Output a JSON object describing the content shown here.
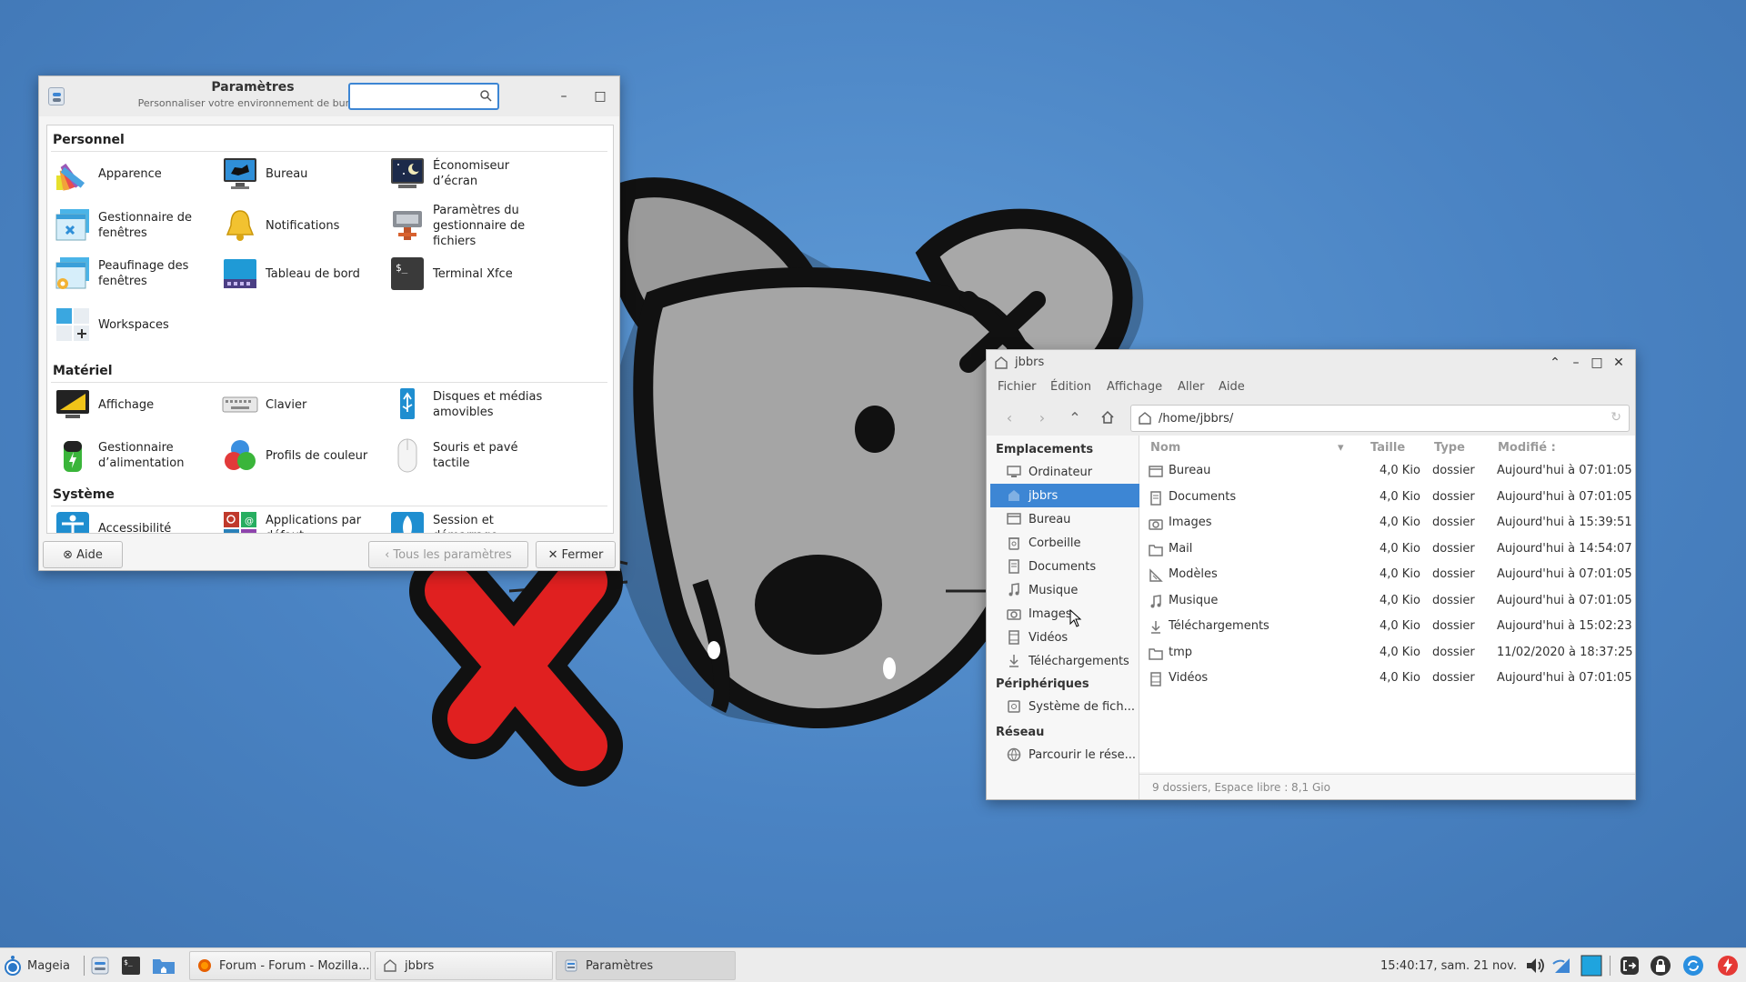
{
  "settings": {
    "title": "Paramètres",
    "subtitle": "Personnaliser votre environnement de bureau",
    "search_value": "",
    "sections": {
      "personnel": "Personnel",
      "materiel": "Matériel",
      "systeme": "Système"
    },
    "items": {
      "apparence": "Apparence",
      "bureau": "Bureau",
      "economiseur": "Économiseur d’écran",
      "gestionnaire_fenetres": "Gestionnaire de fenêtres",
      "notifications": "Notifications",
      "param_gestionnaire_fichiers": "Paramètres du gestionnaire de fichiers",
      "peaufinage": "Peaufinage des fenêtres",
      "tableau_de_bord": "Tableau de bord",
      "terminal": "Terminal Xfce",
      "workspaces": "Workspaces",
      "affichage": "Affichage",
      "clavier": "Clavier",
      "disques": "Disques et médias amovibles",
      "alimentation": "Gestionnaire d’alimentation",
      "profils_couleur": "Profils de couleur",
      "souris": "Souris et pavé tactile",
      "accessibilite": "Accessibilité",
      "applications_defaut": "Applications par défaut",
      "session": "Session et démarrage"
    },
    "footer": {
      "help": "Aide",
      "all_settings": "Tous les paramètres",
      "close": "Fermer"
    }
  },
  "filemanager": {
    "title": "jbbrs",
    "menu": [
      "Fichier",
      "Édition",
      "Affichage",
      "Aller",
      "Aide"
    ],
    "location": "/home/jbbrs/",
    "sidebar": {
      "places_header": "Emplacements",
      "places": [
        "Ordinateur",
        "jbbrs",
        "Bureau",
        "Corbeille",
        "Documents",
        "Musique",
        "Images",
        "Vidéos",
        "Téléchargements"
      ],
      "selected": "jbbrs",
      "devices_header": "Périphériques",
      "devices": [
        "Système de fich..."
      ],
      "network_header": "Réseau",
      "network": [
        "Parcourir le rése..."
      ]
    },
    "columns": {
      "name": "Nom",
      "size": "Taille",
      "type": "Type",
      "modified": "Modifié :"
    },
    "rows": [
      {
        "name": "Bureau",
        "size": "4,0 Kio",
        "type": "dossier",
        "modified": "Aujourd'hui à 07:01:05",
        "icon": "desktop-folder-icon"
      },
      {
        "name": "Documents",
        "size": "4,0 Kio",
        "type": "dossier",
        "modified": "Aujourd'hui à 07:01:05",
        "icon": "documents-folder-icon"
      },
      {
        "name": "Images",
        "size": "4,0 Kio",
        "type": "dossier",
        "modified": "Aujourd'hui à 15:39:51",
        "icon": "pictures-folder-icon"
      },
      {
        "name": "Mail",
        "size": "4,0 Kio",
        "type": "dossier",
        "modified": "Aujourd'hui à 14:54:07",
        "icon": "folder-icon"
      },
      {
        "name": "Modèles",
        "size": "4,0 Kio",
        "type": "dossier",
        "modified": "Aujourd'hui à 07:01:05",
        "icon": "templates-folder-icon"
      },
      {
        "name": "Musique",
        "size": "4,0 Kio",
        "type": "dossier",
        "modified": "Aujourd'hui à 07:01:05",
        "icon": "music-folder-icon"
      },
      {
        "name": "Téléchargements",
        "size": "4,0 Kio",
        "type": "dossier",
        "modified": "Aujourd'hui à 15:02:23",
        "icon": "downloads-folder-icon"
      },
      {
        "name": "tmp",
        "size": "4,0 Kio",
        "type": "dossier",
        "modified": "11/02/2020 à 18:37:25",
        "icon": "folder-icon"
      },
      {
        "name": "Vidéos",
        "size": "4,0 Kio",
        "type": "dossier",
        "modified": "Aujourd'hui à 07:01:05",
        "icon": "videos-folder-icon"
      }
    ],
    "status": "9 dossiers, Espace libre : 8,1 Gio"
  },
  "taskbar": {
    "menu_label": "Mageia",
    "tasks": [
      "Forum - Forum - Mozilla...",
      "jbbrs",
      "Paramètres"
    ],
    "clock": "15:40:17, sam. 21 nov."
  },
  "colors": {
    "accent": "#3d86d4",
    "desktop": "#4d86c6"
  }
}
